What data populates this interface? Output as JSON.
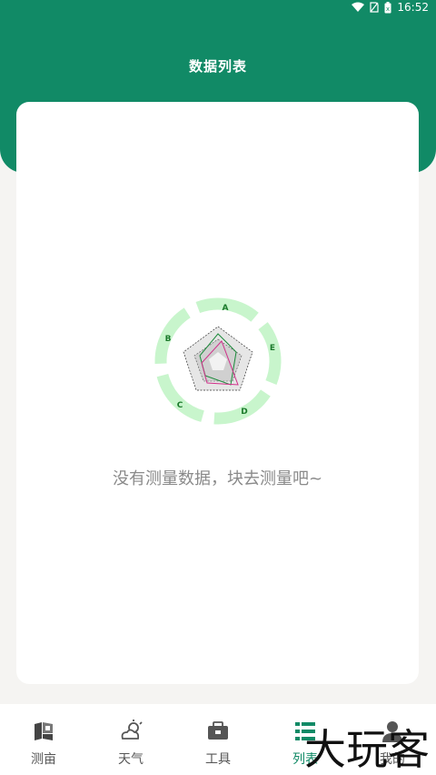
{
  "status": {
    "time": "16:52"
  },
  "header": {
    "title": "数据列表"
  },
  "empty_state": {
    "message": "没有测量数据，块去测量吧~",
    "radar_labels": [
      "A",
      "E",
      "D",
      "C",
      "B"
    ]
  },
  "nav": {
    "items": [
      {
        "label": "测亩",
        "icon": "map-icon"
      },
      {
        "label": "天气",
        "icon": "weather-icon"
      },
      {
        "label": "工具",
        "icon": "toolbox-icon"
      },
      {
        "label": "列表",
        "icon": "list-icon",
        "active": true
      },
      {
        "label": "我的",
        "icon": "user-icon"
      }
    ]
  },
  "watermark": {
    "text": "大玩客"
  },
  "colors": {
    "primary": "#118a66",
    "ring": "#c8f5cc"
  }
}
